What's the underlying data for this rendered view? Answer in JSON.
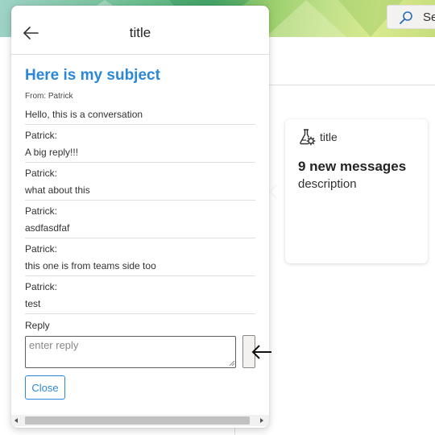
{
  "background": {
    "search": {
      "label": "Se",
      "icon": "search-icon"
    }
  },
  "card": {
    "icon": "flask-gear-icon",
    "title": "title",
    "heading": "9 new messages",
    "description": "description"
  },
  "panel": {
    "back_icon": "back-arrow-icon",
    "title": "title",
    "subject": "Here is my subject",
    "from": "From: Patrick",
    "messages": [
      {
        "text": "Hello, this is a conversation"
      },
      {
        "author": "Patrick:",
        "text": "A big reply!!!"
      },
      {
        "author": "Patrick:",
        "text": "what about this"
      },
      {
        "author": "Patrick:",
        "text": "asdfasdfaf"
      },
      {
        "author": "Patrick:",
        "text": "this one is from teams side too"
      },
      {
        "author": "Patrick:",
        "text": "test"
      }
    ],
    "reply": {
      "label": "Reply",
      "placeholder": "enter reply",
      "value": ""
    },
    "close_label": "Close"
  },
  "colors": {
    "accent": "#2b88d8",
    "text": "#323130",
    "divider": "#e1dfdd"
  }
}
